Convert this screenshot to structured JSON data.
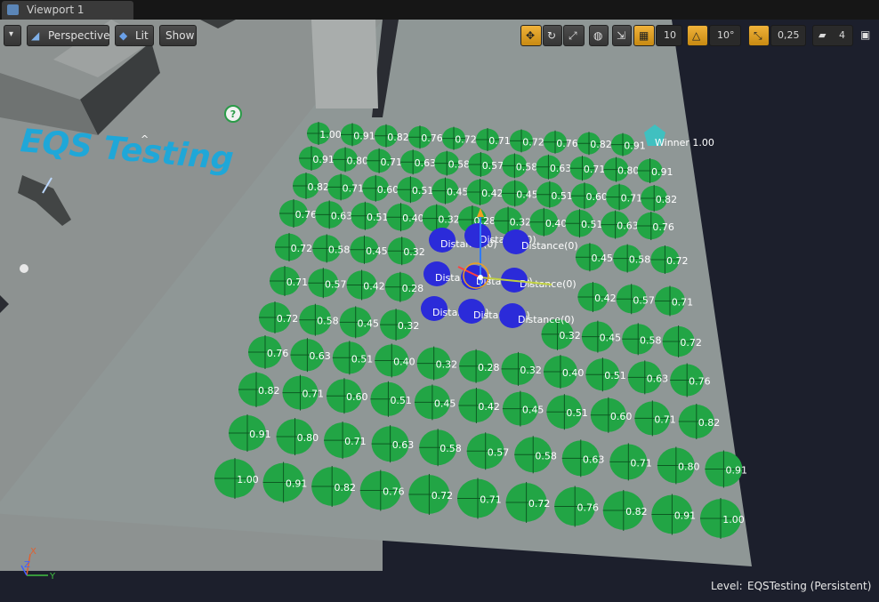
{
  "tab": {
    "title": "Viewport 1"
  },
  "toolbar": {
    "perspective_label": "Perspective",
    "lit_label": "Lit",
    "show_label": "Show",
    "grid_snap_value": "10",
    "rotation_snap_value": "10°",
    "scale_snap_value": "0,25",
    "camera_speed_value": "4"
  },
  "scene": {
    "title_text": "EQS Testing",
    "winner_label": "Winner 1.00",
    "distance_label": "Distance(0)",
    "title_color": "#1fa7d8",
    "item_color": "#22a545",
    "center_color": "#2b2bd9",
    "winner_color": "#40c0c0"
  },
  "grid": {
    "rows": [
      [
        "1.00",
        "0.91",
        "0.82",
        "0.76",
        "0.72",
        "0.71",
        "0.72",
        "0.76",
        "0.82",
        "0.91"
      ],
      [
        "0.91",
        "0.80",
        "0.71",
        "0.63",
        "0.58",
        "0.57",
        "0.58",
        "0.63",
        "0.71",
        "0.80",
        "0.91"
      ],
      [
        "0.82",
        "0.71",
        "0.60",
        "0.51",
        "0.45",
        "0.42",
        "0.45",
        "0.51",
        "0.60",
        "0.71",
        "0.82"
      ],
      [
        "0.76",
        "0.63",
        "0.51",
        "0.40",
        "0.32",
        "0.28",
        "0.32",
        "0.40",
        "0.51",
        "0.63",
        "0.76"
      ],
      [
        "0.72",
        "0.58",
        "0.45",
        "0.32",
        "",
        "",
        "",
        "",
        "0.45",
        "0.58",
        "0.72"
      ],
      [
        "0.71",
        "0.57",
        "0.42",
        "0.28",
        "",
        "",
        "",
        "",
        "0.42",
        "0.57",
        "0.71"
      ],
      [
        "0.72",
        "0.58",
        "0.45",
        "0.32",
        "",
        "",
        "",
        "0.32",
        "0.45",
        "0.58",
        "0.72"
      ],
      [
        "0.76",
        "0.63",
        "0.51",
        "0.40",
        "0.32",
        "0.28",
        "0.32",
        "0.40",
        "0.51",
        "0.63",
        "0.76"
      ],
      [
        "0.82",
        "0.71",
        "0.60",
        "0.51",
        "0.45",
        "0.42",
        "0.45",
        "0.51",
        "0.60",
        "0.71",
        "0.82"
      ],
      [
        "0.91",
        "0.80",
        "0.71",
        "0.63",
        "0.58",
        "0.57",
        "0.58",
        "0.63",
        "0.71",
        "0.80",
        "0.91"
      ],
      [
        "1.00",
        "0.91",
        "0.82",
        "0.76",
        "0.72",
        "0.71",
        "0.72",
        "0.76",
        "0.82",
        "0.91",
        "1.00"
      ]
    ]
  },
  "axis": {
    "x": "X",
    "y": "Y",
    "z": "Z"
  },
  "status": {
    "level_label": "Level:",
    "level_name": "EQSTesting (Persistent)"
  }
}
